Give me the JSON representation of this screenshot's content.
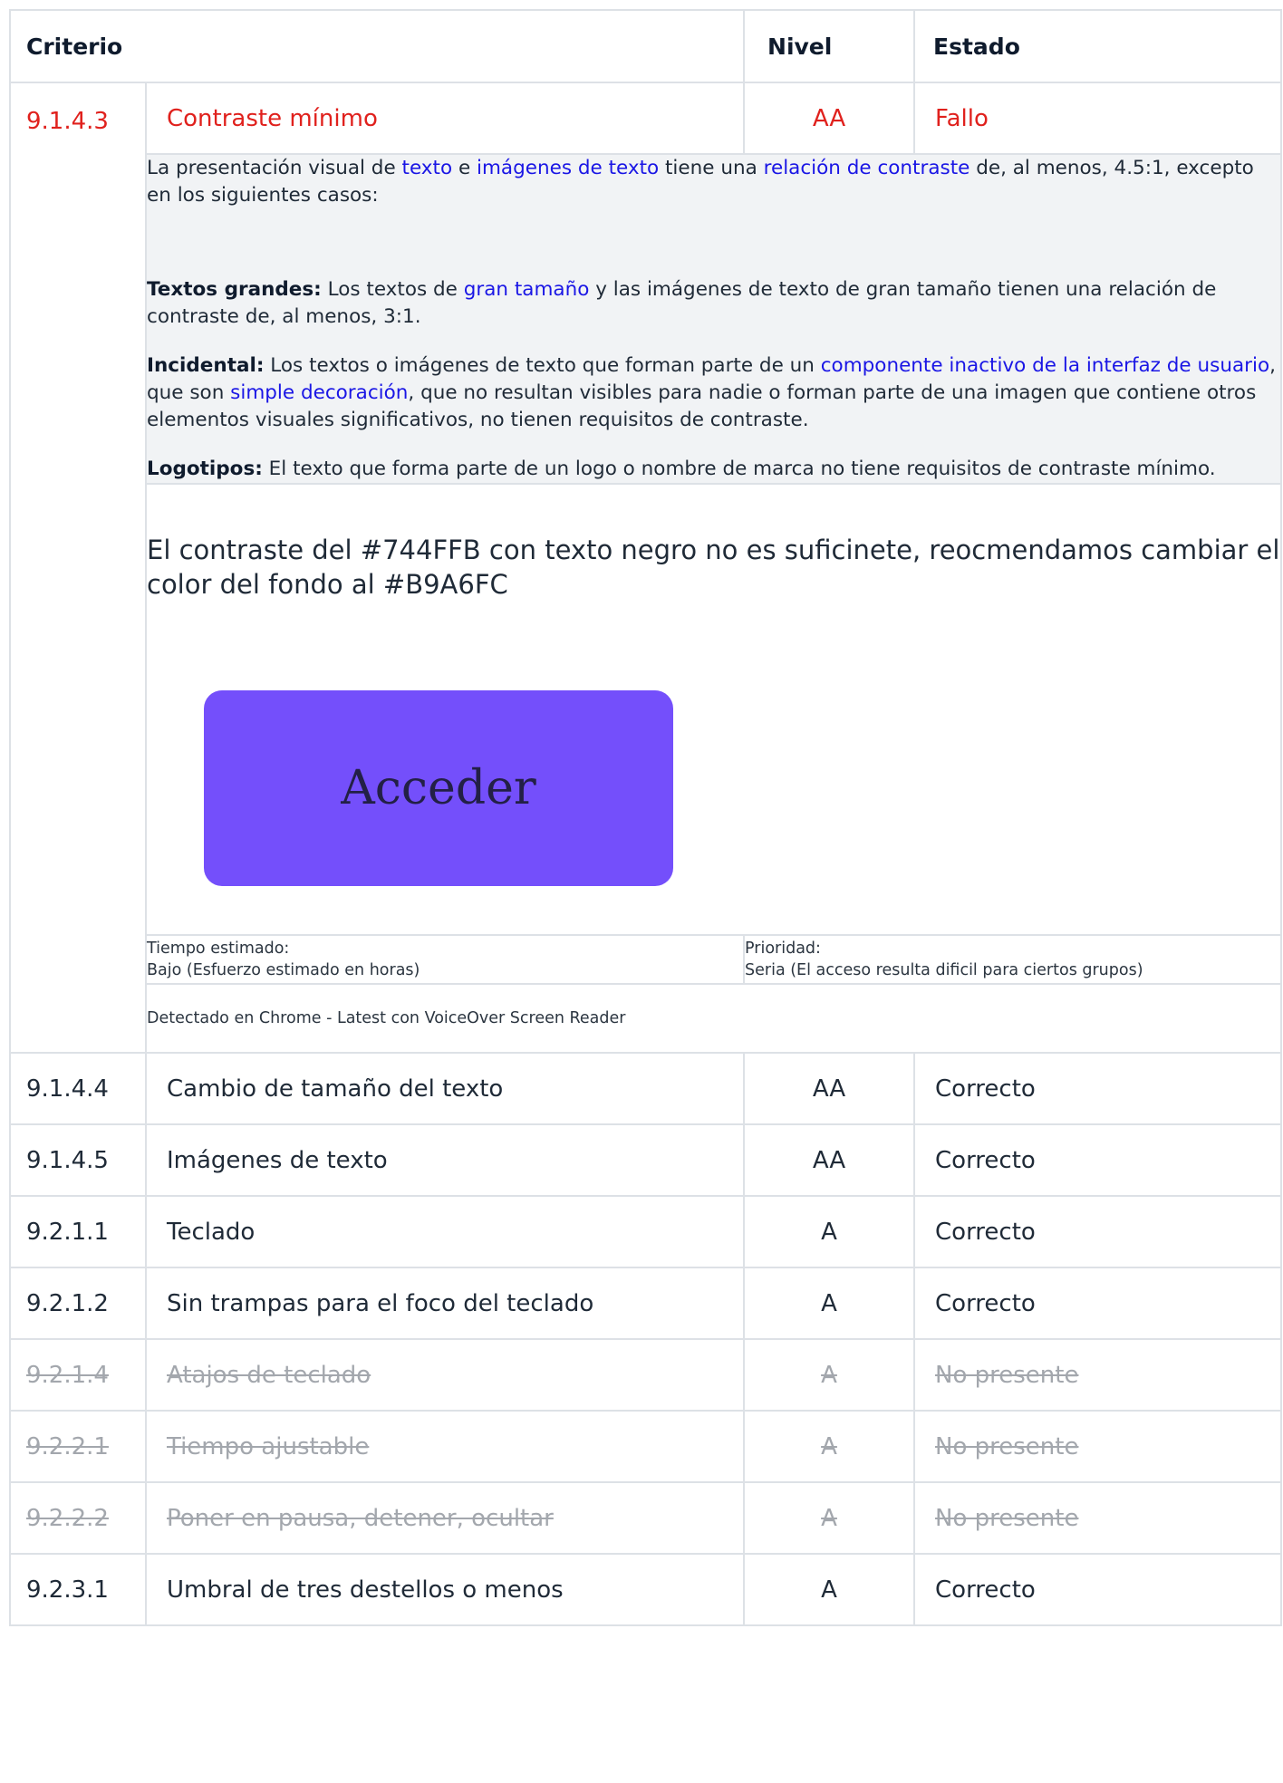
{
  "header": {
    "criterio": "Criterio",
    "nivel": "Nivel",
    "estado": "Estado"
  },
  "expanded": {
    "id": "9.1.4.3",
    "name": "Contraste mínimo",
    "level": "AA",
    "state": "Fallo",
    "description": {
      "intro": [
        "La presentación visual de ",
        "texto",
        " e ",
        "imágenes de texto",
        " tiene una ",
        "relación de contraste",
        " de, al menos, 4.5:1, excepto en los siguientes casos:"
      ],
      "large": {
        "label": "Textos grandes:",
        "t1": " Los textos de ",
        "link": "gran tamaño",
        "t2": " y las imágenes de texto de gran tamaño tienen una relación de contraste de, al menos, 3:1."
      },
      "incidental": {
        "label": "Incidental:",
        "t1": " Los textos o imágenes de texto que forman parte de un ",
        "link1": "componente inactivo de la interfaz de usuario",
        "t2": ", que son ",
        "link2": "simple decoración",
        "t3": ", que no resultan visibles para nadie o forman parte de una imagen que contiene otros elementos visuales significativos, no tienen requisitos de contraste."
      },
      "logos": {
        "label": "Logotipos:",
        "t1": " El texto que forma parte de un logo o nombre de marca no tiene requisitos de contraste mínimo."
      }
    },
    "comment": "El contraste del #744FFB con texto negro no es suficinete, reocmendamos cambiar el color del fondo al #B9A6FC",
    "example_button": {
      "label": "Acceder",
      "color": "#744FFB"
    },
    "estimated_time": {
      "label": "Tiempo estimado:",
      "value": "Bajo (Esfuerzo estimado en horas)"
    },
    "priority": {
      "label": "Prioridad:",
      "value": "Seria (El acceso resulta dificil para ciertos grupos)"
    },
    "detected": "Detectado en Chrome - Latest con VoiceOver Screen Reader"
  },
  "rows": [
    {
      "id": "9.1.4.4",
      "name": "Cambio de tamaño del texto",
      "level": "AA",
      "state": "Correcto"
    },
    {
      "id": "9.1.4.5",
      "name": "Imágenes de texto",
      "level": "AA",
      "state": "Correcto"
    },
    {
      "id": "9.2.1.1",
      "name": "Teclado",
      "level": "A",
      "state": "Correcto"
    },
    {
      "id": "9.2.1.2",
      "name": "Sin trampas para el foco del teclado",
      "level": "A",
      "state": "Correcto"
    },
    {
      "id": "9.2.1.4",
      "name": "Atajos de teclado",
      "level": "A",
      "state": "No presente"
    },
    {
      "id": "9.2.2.1",
      "name": "Tiempo ajustable",
      "level": "A",
      "state": "No presente"
    },
    {
      "id": "9.2.2.2",
      "name": "Poner en pausa, detener, ocultar",
      "level": "A",
      "state": "No presente"
    },
    {
      "id": "9.2.3.1",
      "name": "Umbral de tres destellos o menos",
      "level": "A",
      "state": "Correcto"
    }
  ],
  "colors": {
    "fail": "#E0211D",
    "link": "#1A16E5",
    "absent": "#A3A7AD",
    "panel": "#F1F3F5"
  }
}
